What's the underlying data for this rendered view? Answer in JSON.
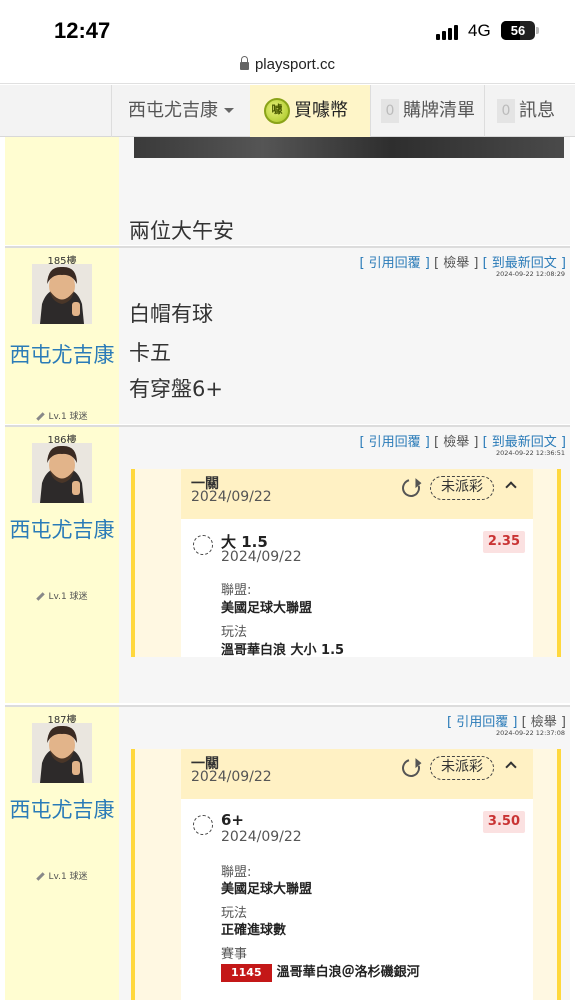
{
  "status_bar": {
    "time": "12:47",
    "network": "4G",
    "battery": "56",
    "battery_fraction": 0.56
  },
  "browser": {
    "url": "playsport.cc"
  },
  "nav": {
    "user_menu": "西屯尤吉康",
    "buy_coin": "買噱幣",
    "coin_icon_text": "噱",
    "cart_count": "0",
    "cart_label": "購牌清單",
    "msg_count": "0",
    "msg_label": "訊息"
  },
  "partial_post": {
    "text": "兩位大午安"
  },
  "posts": [
    {
      "floor": "185樓",
      "username": "西屯尤吉康",
      "level": "Lv.1 球迷",
      "actions": {
        "quote": "[ 引用回覆 ]",
        "report": "[ 檢舉 ]",
        "latest": "[ 到最新回文 ]"
      },
      "timestamp": "2024-09-22 12:08:29",
      "lines": [
        "白帽有球",
        "卡五",
        "有穿盤6+"
      ]
    },
    {
      "floor": "186樓",
      "username": "西屯尤吉康",
      "level": "Lv.1 球迷",
      "actions": {
        "quote": "[ 引用回覆 ]",
        "report": "[ 檢舉 ]",
        "latest": "[ 到最新回文 ]"
      },
      "timestamp": "2024-09-22 12:36:51",
      "card": {
        "title": "一關",
        "date": "2024/09/22",
        "status": "未派彩",
        "pick": "大 1.5",
        "pick_date": "2024/09/22",
        "odds": "2.35",
        "league_label": "聯盟:",
        "league": "美國足球大聯盟",
        "play_label": "玩法",
        "play": "溫哥華白浪 大小 1.5"
      }
    },
    {
      "floor": "187樓",
      "username": "西屯尤吉康",
      "level": "Lv.1 球迷",
      "actions": {
        "quote": "[ 引用回覆 ]",
        "report": "[ 檢舉 ]"
      },
      "timestamp": "2024-09-22 12:37:08",
      "card": {
        "title": "一關",
        "date": "2024/09/22",
        "status": "未派彩",
        "pick": "6+",
        "pick_date": "2024/09/22",
        "odds": "3.50",
        "league_label": "聯盟:",
        "league": "美國足球大聯盟",
        "play_label": "玩法",
        "play": "正確進球數",
        "match_label": "賽事",
        "game_id": "1145",
        "match": "溫哥華白浪＠洛杉磯銀河"
      }
    }
  ],
  "colors": {
    "link": "#2a7bb8",
    "sidebar": "#fffdd1",
    "card_border": "#ffd83d",
    "odds_text": "#c93333",
    "game_id_bg": "#c41818"
  }
}
